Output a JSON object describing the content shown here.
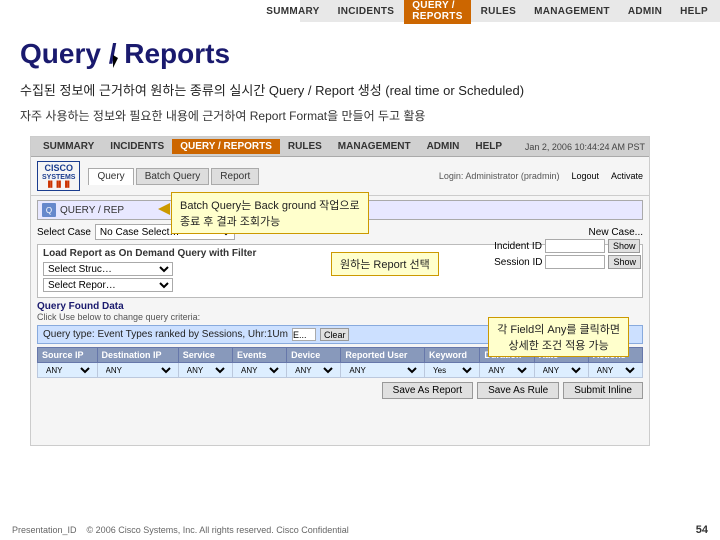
{
  "topnav": {
    "items": [
      {
        "label": "SUMMARY",
        "active": false
      },
      {
        "label": "INCIDENTS",
        "active": false
      },
      {
        "label": "QUERY / REPORTS",
        "active": true
      },
      {
        "label": "RULES",
        "active": false
      },
      {
        "label": "MANAGEMENT",
        "active": false
      },
      {
        "label": "ADMIN",
        "active": false
      },
      {
        "label": "HELP",
        "active": false
      }
    ]
  },
  "page": {
    "title": "Query / Reports",
    "subtitle1": "수집된 정보에 근거하여 원하는 종류의 실시간 Query / Report 생성 (real time or Scheduled)",
    "subtitle2": "자주 사용하는 정보와 필요한 내용에 근거하여 Report Format을 만들어 두고 활용"
  },
  "inner": {
    "topnav": {
      "items": [
        {
          "label": "SUMMARY",
          "active": false
        },
        {
          "label": "INCIDENTS",
          "active": false
        },
        {
          "label": "QUERY / REPORTS",
          "active": true
        },
        {
          "label": "RULES",
          "active": false
        },
        {
          "label": "MANAGEMENT",
          "active": false
        },
        {
          "label": "ADMIN",
          "active": false
        },
        {
          "label": "HELP",
          "active": false
        }
      ],
      "timestamp": "Jan 2, 2006 10:44:24 AM PST",
      "login_info": "Login: Administrator (pradmin)"
    },
    "tabs": [
      {
        "label": "Query",
        "active": true
      },
      {
        "label": "Batch Query",
        "active": false
      },
      {
        "label": "Report",
        "active": false
      }
    ],
    "breadcrumb": "QUERY / REP",
    "callout_batch": "Batch Query는 Back ground 작업으로\n종료 후 결과 조회가능",
    "select_case_label": "Select Case",
    "select_case_value": "No Case Select…",
    "load_report": {
      "title": "Load Report as On Demand Query with Filter",
      "select1_label": "Select Struc…",
      "select2_label": "Select Repor…"
    },
    "side_fields": {
      "incident_id_label": "Incident ID",
      "session_id_label": "Session ID",
      "show_btn": "Show",
      "show_btn2": "Show"
    },
    "report_callout": "원하는 Report 선택",
    "qfd": {
      "title": "Query Found Data",
      "subtitle": "Click Use below to change query criteria:"
    },
    "query_type": {
      "label": "Query type: Event Types ranked by Sessions, Uhr:1Um",
      "input_value": "E...",
      "clear_btn": "Clear"
    },
    "table": {
      "headers": [
        "Source IP",
        "Destination IP",
        "Service",
        "Events",
        "Device",
        "Reported User",
        "Keyword",
        "Duration",
        "Rate",
        "Actions"
      ],
      "row": [
        "ANY",
        "ANY",
        "ANY",
        "ANY",
        "ANY",
        "ANY",
        "ANY",
        "Yes",
        "ANY",
        "ANY"
      ]
    },
    "field_callout": "각 Field의 Any를 클릭하면\n상세한 조건 적용 가능",
    "bottom_buttons": [
      "Save As Report",
      "Save As Rule",
      "Submit Inline"
    ]
  },
  "footer": {
    "presentation_id": "Presentation_ID",
    "copyright": "© 2006 Cisco Systems, Inc. All rights reserved.    Cisco Confidential",
    "page_number": "54"
  }
}
